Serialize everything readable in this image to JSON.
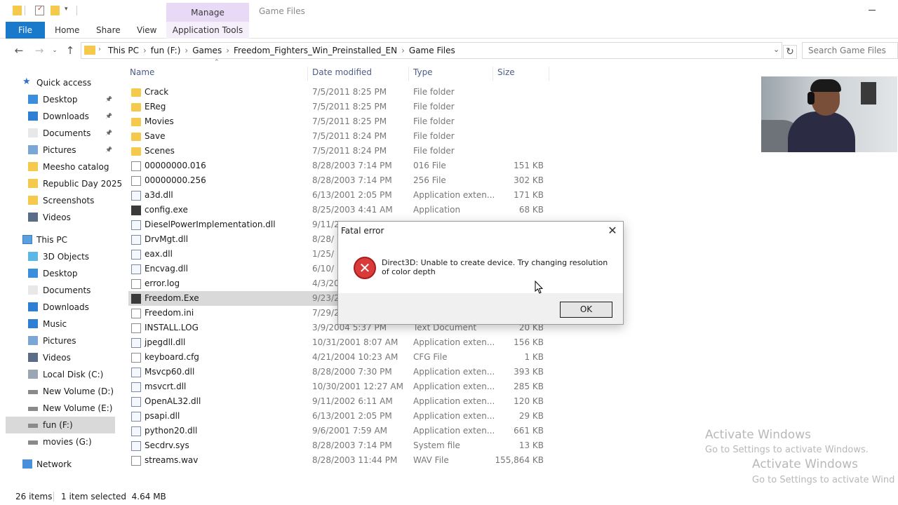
{
  "title_bar": {
    "manage_tab": "Manage",
    "window_title": "Game Files"
  },
  "ribbon": {
    "tabs": [
      "File",
      "Home",
      "Share",
      "View",
      "Application Tools"
    ]
  },
  "address_bar": {
    "breadcrumbs": [
      "This PC",
      "fun  (F:)",
      "Games",
      "Freedom_Fighters_Win_Preinstalled_EN",
      "Game Files"
    ],
    "search_placeholder": "Search Game Files"
  },
  "sidebar": {
    "quick_access": "Quick access",
    "quick_items": [
      {
        "label": "Desktop",
        "icon": "desktop-icon",
        "pinned": true
      },
      {
        "label": "Downloads",
        "icon": "downloads-icon",
        "pinned": true
      },
      {
        "label": "Documents",
        "icon": "documents-icon",
        "pinned": true
      },
      {
        "label": "Pictures",
        "icon": "pictures-icon",
        "pinned": true
      },
      {
        "label": "Meesho catalog",
        "icon": "folder-icon",
        "pinned": false
      },
      {
        "label": "Republic Day 2025",
        "icon": "folder-icon",
        "pinned": false
      },
      {
        "label": "Screenshots",
        "icon": "folder-icon",
        "pinned": false
      },
      {
        "label": "Videos",
        "icon": "videos-icon",
        "pinned": false
      }
    ],
    "this_pc": "This PC",
    "pc_items": [
      {
        "label": "3D Objects",
        "icon": "3d-objects-icon"
      },
      {
        "label": "Desktop",
        "icon": "desktop-icon"
      },
      {
        "label": "Documents",
        "icon": "documents-icon"
      },
      {
        "label": "Downloads",
        "icon": "downloads-icon"
      },
      {
        "label": "Music",
        "icon": "music-icon"
      },
      {
        "label": "Pictures",
        "icon": "pictures-icon"
      },
      {
        "label": "Videos",
        "icon": "videos-icon"
      },
      {
        "label": "Local Disk (C:)",
        "icon": "local-disk-icon"
      },
      {
        "label": "New Volume (D:)",
        "icon": "drive-icon"
      },
      {
        "label": "New Volume (E:)",
        "icon": "drive-icon"
      },
      {
        "label": "fun  (F:)",
        "icon": "drive-icon",
        "selected": true
      },
      {
        "label": "movies (G:)",
        "icon": "drive-icon"
      }
    ],
    "network": "Network"
  },
  "columns": {
    "name": "Name",
    "date": "Date modified",
    "type": "Type",
    "size": "Size"
  },
  "files": [
    {
      "name": "Crack",
      "date": "7/5/2011 8:25 PM",
      "type": "File folder",
      "size": "",
      "kind": "folder"
    },
    {
      "name": "EReg",
      "date": "7/5/2011 8:25 PM",
      "type": "File folder",
      "size": "",
      "kind": "folder"
    },
    {
      "name": "Movies",
      "date": "7/5/2011 8:25 PM",
      "type": "File folder",
      "size": "",
      "kind": "folder"
    },
    {
      "name": "Save",
      "date": "7/5/2011 8:24 PM",
      "type": "File folder",
      "size": "",
      "kind": "folder"
    },
    {
      "name": "Scenes",
      "date": "7/5/2011 8:24 PM",
      "type": "File folder",
      "size": "",
      "kind": "folder"
    },
    {
      "name": "00000000.016",
      "date": "8/28/2003 7:14 PM",
      "type": "016 File",
      "size": "151 KB",
      "kind": "file"
    },
    {
      "name": "00000000.256",
      "date": "8/28/2003 7:14 PM",
      "type": "256 File",
      "size": "302 KB",
      "kind": "file"
    },
    {
      "name": "a3d.dll",
      "date": "6/13/2001 2:05 PM",
      "type": "Application exten...",
      "size": "171 KB",
      "kind": "dll"
    },
    {
      "name": "config.exe",
      "date": "8/25/2003 4:41 AM",
      "type": "Application",
      "size": "68 KB",
      "kind": "exe"
    },
    {
      "name": "DieselPowerImplementation.dll",
      "date": "9/11/2",
      "type": "",
      "size": "",
      "kind": "dll"
    },
    {
      "name": "DrvMgt.dll",
      "date": "8/28/",
      "type": "",
      "size": "",
      "kind": "dll"
    },
    {
      "name": "eax.dll",
      "date": "1/25/",
      "type": "",
      "size": "",
      "kind": "dll"
    },
    {
      "name": "Encvag.dll",
      "date": "6/10/",
      "type": "",
      "size": "",
      "kind": "dll"
    },
    {
      "name": "error.log",
      "date": "4/3/20",
      "type": "",
      "size": "",
      "kind": "file"
    },
    {
      "name": "Freedom.Exe",
      "date": "9/23/2",
      "type": "",
      "size": "",
      "kind": "exe",
      "selected": true
    },
    {
      "name": "Freedom.ini",
      "date": "7/29/2",
      "type": "",
      "size": "",
      "kind": "file"
    },
    {
      "name": "INSTALL.LOG",
      "date": "3/9/2004 5:37 PM",
      "type": "Text Document",
      "size": "20 KB",
      "kind": "file"
    },
    {
      "name": "jpegdll.dll",
      "date": "10/31/2001 8:07 AM",
      "type": "Application exten...",
      "size": "156 KB",
      "kind": "dll"
    },
    {
      "name": "keyboard.cfg",
      "date": "4/21/2004 10:23 AM",
      "type": "CFG File",
      "size": "1 KB",
      "kind": "file"
    },
    {
      "name": "Msvcp60.dll",
      "date": "8/28/2000 7:30 PM",
      "type": "Application exten...",
      "size": "393 KB",
      "kind": "dll"
    },
    {
      "name": "msvcrt.dll",
      "date": "10/30/2001 12:27 AM",
      "type": "Application exten...",
      "size": "285 KB",
      "kind": "dll"
    },
    {
      "name": "OpenAL32.dll",
      "date": "9/11/2002 6:11 AM",
      "type": "Application exten...",
      "size": "120 KB",
      "kind": "dll"
    },
    {
      "name": "psapi.dll",
      "date": "6/13/2001 2:05 PM",
      "type": "Application exten...",
      "size": "29 KB",
      "kind": "dll"
    },
    {
      "name": "python20.dll",
      "date": "9/6/2001 7:59 AM",
      "type": "Application exten...",
      "size": "661 KB",
      "kind": "dll"
    },
    {
      "name": "Secdrv.sys",
      "date": "8/28/2003 7:14 PM",
      "type": "System file",
      "size": "13 KB",
      "kind": "dll"
    },
    {
      "name": "streams.wav",
      "date": "8/28/2003 11:44 PM",
      "type": "WAV File",
      "size": "155,864 KB",
      "kind": "wav"
    }
  ],
  "status_bar": {
    "items": "26 items",
    "selected": "1 item selected  4.64 MB"
  },
  "dialog": {
    "title": "Fatal error",
    "message": "Direct3D: Unable to create device. Try changing resolution of color depth",
    "ok_label": "OK"
  },
  "watermark": {
    "line1": "Activate Windows",
    "line2": "Go to Settings to activate Windows.",
    "line1b": "Activate Windows",
    "line2b": "Go to Settings to activate Wind"
  },
  "colors": {
    "accent": "#1979ca",
    "manage_tab": "#e8d9f7",
    "folder": "#f5c94c",
    "error": "#d93a3a",
    "selection": "#d9d9d9"
  }
}
